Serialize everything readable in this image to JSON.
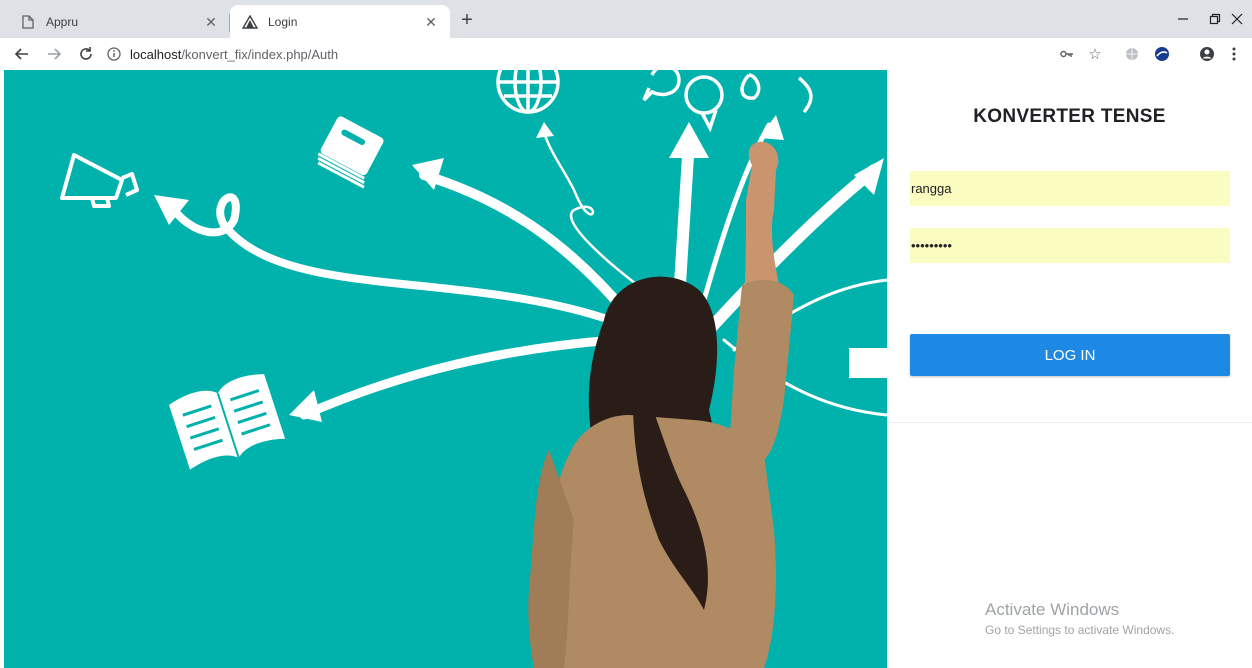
{
  "browser": {
    "tabs": [
      {
        "label": "Appru",
        "icon": "page-icon",
        "active": false
      },
      {
        "label": "Login",
        "icon": "site-logo-icon",
        "active": true
      }
    ],
    "url": {
      "host": "localhost",
      "path": "/konvert_fix/index.php/Auth"
    }
  },
  "login": {
    "title": "KONVERTER TENSE",
    "username": "rangga",
    "password": "•••••••••",
    "button": "LOG IN"
  },
  "watermark": {
    "line1": "Activate Windows",
    "line2": "Go to Settings to activate Windows."
  }
}
